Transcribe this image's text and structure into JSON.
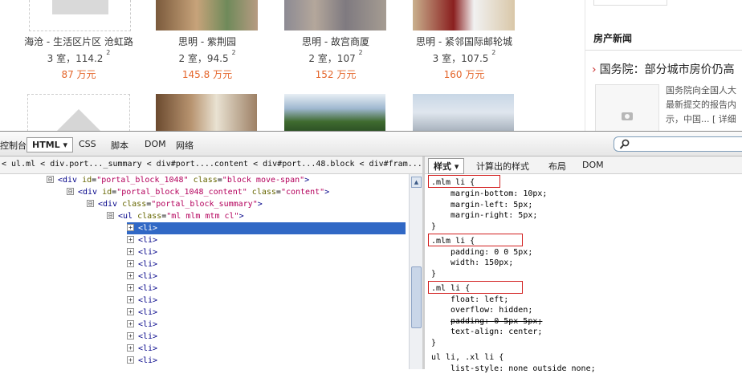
{
  "listings": [
    {
      "name": "海沧 - 生活区片区 沧虹路",
      "size_prefix": "3 室，114.2 ",
      "size_sup": "2",
      "price": "87 万元"
    },
    {
      "name": "思明 - 紫荆园",
      "size_prefix": "2 室，94.5 ",
      "size_sup": "2",
      "price": "145.8 万元"
    },
    {
      "name": "思明 - 故宫商厦",
      "size_prefix": "2 室，107 ",
      "size_sup": "2",
      "price": "152 万元"
    },
    {
      "name": "思明 - 紧邻国际邮轮城",
      "size_prefix": "3 室，107.5 ",
      "size_sup": "2",
      "price": "160 万元"
    }
  ],
  "news": {
    "section_title": "房产新闻",
    "headline": "国务院：部分城市房价仍高",
    "summary_lines": [
      "国务院向全国人大",
      "最新提交的报告内",
      "示，中国... [ 详细"
    ]
  },
  "firebug": {
    "toolbar_tabs": [
      "控制台",
      "HTML ▾",
      "CSS",
      "脚本",
      "DOM",
      "网络"
    ],
    "breadcrumb": "< ul.ml < div.port..._summary < div#port....content < div#port...48.block < div#fram...t. ▸",
    "side_tabs": [
      "样式 ▾",
      "计算出的样式",
      "布局",
      "DOM"
    ],
    "html_lines": [
      {
        "indent": 0,
        "toggle": "⊟",
        "tag_open": "<div ",
        "attrs": [
          [
            "id",
            "portal_block_1048"
          ],
          [
            "class",
            "block move-span"
          ]
        ],
        "tag_close": ">"
      },
      {
        "indent": 1,
        "toggle": "⊟",
        "tag_open": "<div ",
        "attrs": [
          [
            "id",
            "portal_block_1048_content"
          ],
          [
            "class",
            "content"
          ]
        ],
        "tag_close": ">"
      },
      {
        "indent": 2,
        "toggle": "⊟",
        "tag_open": "<div ",
        "attrs": [
          [
            "class",
            "portal_block_summary"
          ]
        ],
        "tag_close": ">"
      },
      {
        "indent": 3,
        "toggle": "⊟",
        "tag_open": "<ul ",
        "attrs": [
          [
            "class",
            "ml mlm mtm cl"
          ]
        ],
        "tag_close": ">"
      }
    ],
    "li_label": "<li>",
    "li_count": 12,
    "css_rules": [
      {
        "selector": ".mlm li {",
        "props": [
          [
            "margin-bottom",
            "10px;"
          ],
          [
            "margin-left",
            "5px;"
          ],
          [
            "margin-right",
            "5px;"
          ]
        ],
        "boxed": true
      },
      {
        "selector": ".mlm li {",
        "props": [
          [
            "padding",
            "0 0 5px;"
          ],
          [
            "width",
            "150px;"
          ]
        ],
        "boxed": true
      },
      {
        "selector": ".ml li {",
        "props": [
          [
            "float",
            "left;"
          ],
          [
            "overflow",
            "hidden;"
          ],
          [
            "padding",
            "0 5px 5px;"
          ],
          [
            "text-align",
            "center;"
          ]
        ],
        "boxed": true,
        "struck": [
          2
        ]
      },
      {
        "selector": "ul li, .xl li {",
        "props": [
          [
            "list-style",
            "none outside none;"
          ]
        ],
        "boxed": false
      }
    ],
    "close_brace": "}"
  },
  "colors": {
    "price": "#e4652a",
    "selected_row": "#3168c5",
    "red_box": "#d21f1f"
  }
}
